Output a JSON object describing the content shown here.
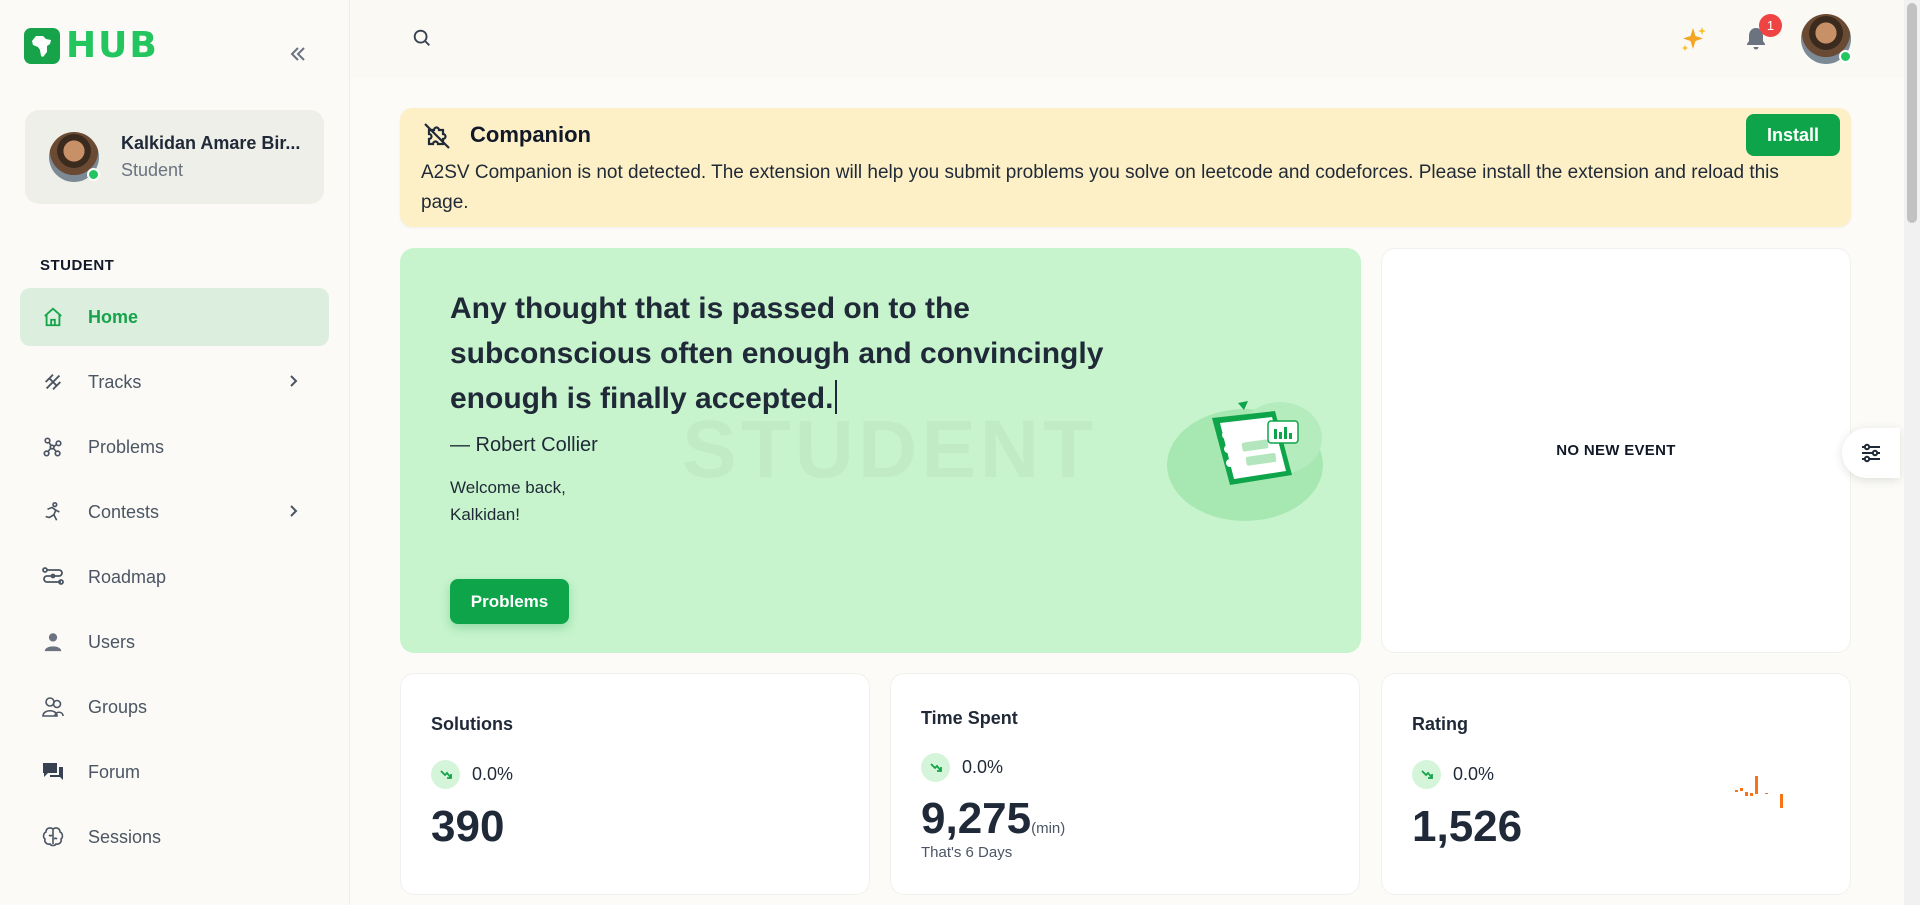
{
  "app": {
    "logo_text": "HUB"
  },
  "user": {
    "name": "Kalkidan Amare Bir...",
    "role": "Student"
  },
  "sidebar": {
    "section_label": "STUDENT",
    "items": [
      {
        "label": "Home",
        "icon": "home-icon",
        "active": true
      },
      {
        "label": "Tracks",
        "icon": "tracks-icon",
        "has_submenu": true
      },
      {
        "label": "Problems",
        "icon": "problems-icon"
      },
      {
        "label": "Contests",
        "icon": "contests-icon",
        "has_submenu": true
      },
      {
        "label": "Roadmap",
        "icon": "roadmap-icon"
      },
      {
        "label": "Users",
        "icon": "users-icon"
      },
      {
        "label": "Groups",
        "icon": "groups-icon"
      },
      {
        "label": "Forum",
        "icon": "forum-icon"
      },
      {
        "label": "Sessions",
        "icon": "sessions-icon"
      }
    ]
  },
  "topbar": {
    "notification_count": "1"
  },
  "banner": {
    "title": "Companion",
    "message": "A2SV Companion is not detected. The extension will help you submit problems you solve on leetcode and codeforces. Please install the extension and reload this page.",
    "install_label": "Install"
  },
  "hero": {
    "quote": "Any thought that is passed on to the subconscious often enough and convincingly enough is finally accepted.",
    "author": "— Robert Collier",
    "welcome_line1": "Welcome back,",
    "welcome_line2": "Kalkidan!",
    "watermark": "STUDENT",
    "button_label": "Problems"
  },
  "event": {
    "empty_text": "NO NEW EVENT"
  },
  "stats": {
    "solutions": {
      "title": "Solutions",
      "trend": "0.0%",
      "value": "390"
    },
    "time_spent": {
      "title": "Time Spent",
      "trend": "0.0%",
      "value": "9,275",
      "unit": "(min)",
      "sub": "That's 6 Days"
    },
    "rating": {
      "title": "Rating",
      "trend": "0.0%",
      "value": "1,526"
    }
  },
  "colors": {
    "accent": "#16a34a",
    "hero_bg": "#c7f4cd",
    "banner_bg": "#fdf0c7",
    "badge": "#ef4444"
  }
}
